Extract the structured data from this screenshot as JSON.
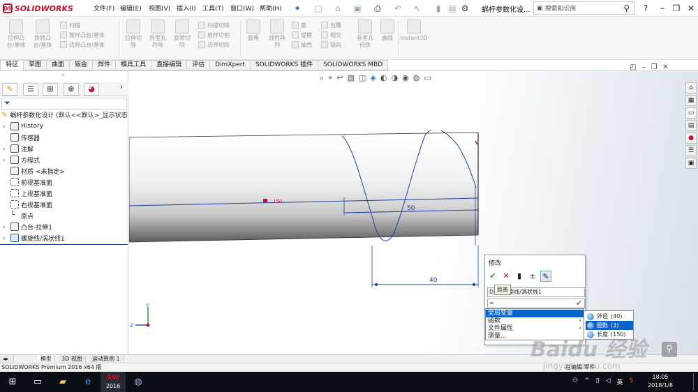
{
  "app": {
    "brand": "SOLIDWORKS",
    "doc_title": "蜗杆参数化设...",
    "search_placeholder": "搜索知识库"
  },
  "menu": [
    "文件(F)",
    "编辑(E)",
    "视图(V)",
    "插入(I)",
    "工具(T)",
    "窗口(W)",
    "帮助(H)"
  ],
  "ribbon": {
    "buttons": [
      {
        "label": "拉伸凸\n台/基体"
      },
      {
        "label": "旋转凸\n台/基体"
      },
      {
        "label": "拉伸切\n除"
      },
      {
        "label": "异型孔\n向导"
      },
      {
        "label": "旋转切\n除"
      },
      {
        "label": "圆角"
      },
      {
        "label": "线性阵\n列"
      },
      {
        "label": "参考几\n何体"
      },
      {
        "label": "曲线"
      },
      {
        "label": "Instant3D"
      }
    ],
    "small": [
      "扫描",
      "放样凸台/基体",
      "边界凸台/基体",
      "扫描切除",
      "放样切割",
      "边界切除",
      "筋",
      "拔模",
      "抽壳",
      "包覆",
      "相交",
      "镜向"
    ]
  },
  "tabs": [
    "特征",
    "草图",
    "曲面",
    "钣金",
    "焊件",
    "模具工具",
    "直接编辑",
    "评估",
    "DimXpert",
    "SOLIDWORKS 插件",
    "SOLIDWORKS MBD"
  ],
  "tree": {
    "root": "蜗杆参数化设计 (默认<<默认>_显示状态",
    "items": [
      {
        "label": "History",
        "expand": true
      },
      {
        "label": "传感器",
        "expand": false
      },
      {
        "label": "注解",
        "expand": true
      },
      {
        "label": "方程式",
        "expand": true
      },
      {
        "label": "材质 <未指定>",
        "expand": false
      },
      {
        "label": "前视基准面",
        "expand": false
      },
      {
        "label": "上视基准面",
        "expand": false
      },
      {
        "label": "右视基准面",
        "expand": false
      },
      {
        "label": "原点",
        "expand": false
      },
      {
        "label": "凸台-拉伸1",
        "expand": true
      },
      {
        "label": "螺旋线/涡状线1",
        "expand": true
      }
    ]
  },
  "viewport": {
    "dim_50": "50",
    "dim_40": "40",
    "dim_red": "150",
    "axis_y": "Y",
    "axis_z": "Z"
  },
  "modify_dialog": {
    "title": "修改",
    "tooltip": "距离",
    "dim_value": "D4@螺旋线/涡状线1",
    "input": "="
  },
  "context_menu": [
    {
      "label": "全局变量",
      "selected": true,
      "sub": false
    },
    {
      "label": "函数",
      "selected": false,
      "sub": true
    },
    {
      "label": "文件属性",
      "selected": false,
      "sub": true
    },
    {
      "label": "测量...",
      "selected": false,
      "sub": false
    }
  ],
  "submenu": [
    {
      "label": "外径",
      "value": "(40)",
      "selected": false
    },
    {
      "label": "圈数",
      "value": "(3)",
      "selected": true
    },
    {
      "label": "长度",
      "value": "(150)",
      "selected": false
    }
  ],
  "bottom_tabs": [
    "模型",
    "3D 视图",
    "运动算例 1"
  ],
  "status": "SOLIDWORKS Premium 2016 x64 版",
  "status_right": "在编辑 零件",
  "taskbar": {
    "sw_label": "2016",
    "lang": "英",
    "time": "18:05",
    "date": "2018/1/8"
  },
  "watermark": {
    "main": "Baidu 经验",
    "sub": "jingyan.baidu.com"
  },
  "colors": {
    "brand_red": "#c8102e",
    "select_blue": "#0a63c9",
    "sketch_blue": "#1e3fa0"
  }
}
